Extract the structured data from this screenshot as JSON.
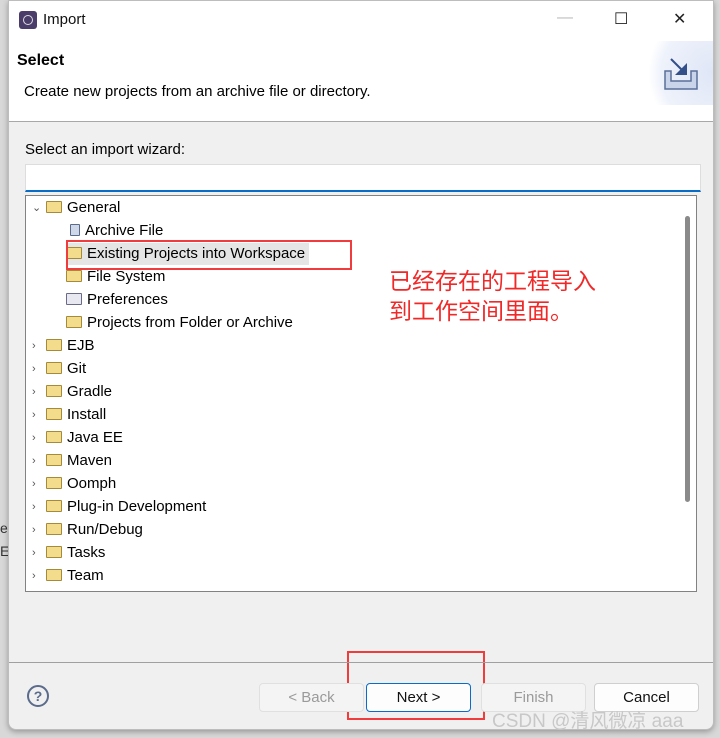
{
  "window": {
    "title": "Import",
    "minimize": "—",
    "maximize": "☐",
    "close": "✕"
  },
  "background": {
    "t1": "e",
    "t2": "E:"
  },
  "header": {
    "title": "Select",
    "description": "Create new projects from an archive file or directory."
  },
  "wizard_label": "Select an import wizard:",
  "filter": {
    "value": ""
  },
  "tree": {
    "items": [
      {
        "label": "General",
        "level": 0,
        "expanded": true,
        "icon": "folder-open"
      },
      {
        "label": "Archive File",
        "level": 1,
        "icon": "archive-icon"
      },
      {
        "label": "Existing Projects into Workspace",
        "level": 1,
        "icon": "project-folder",
        "selected": true
      },
      {
        "label": "File System",
        "level": 1,
        "icon": "folder"
      },
      {
        "label": "Preferences",
        "level": 1,
        "icon": "preferences"
      },
      {
        "label": "Projects from Folder or Archive",
        "level": 1,
        "icon": "folder"
      },
      {
        "label": "EJB",
        "level": 0
      },
      {
        "label": "Git",
        "level": 0
      },
      {
        "label": "Gradle",
        "level": 0
      },
      {
        "label": "Install",
        "level": 0
      },
      {
        "label": "Java EE",
        "level": 0
      },
      {
        "label": "Maven",
        "level": 0
      },
      {
        "label": "Oomph",
        "level": 0
      },
      {
        "label": "Plug-in Development",
        "level": 0
      },
      {
        "label": "Run/Debug",
        "level": 0
      },
      {
        "label": "Tasks",
        "level": 0
      },
      {
        "label": "Team",
        "level": 0
      }
    ]
  },
  "annotation": {
    "line1": "已经存在的工程导入",
    "line2": "到工作空间里面。",
    "color": "#f02828"
  },
  "buttons": {
    "help": "?",
    "back": "< Back",
    "next": "Next >",
    "finish": "Finish",
    "cancel": "Cancel"
  },
  "watermark": "CSDN @清风微凉 aaa"
}
